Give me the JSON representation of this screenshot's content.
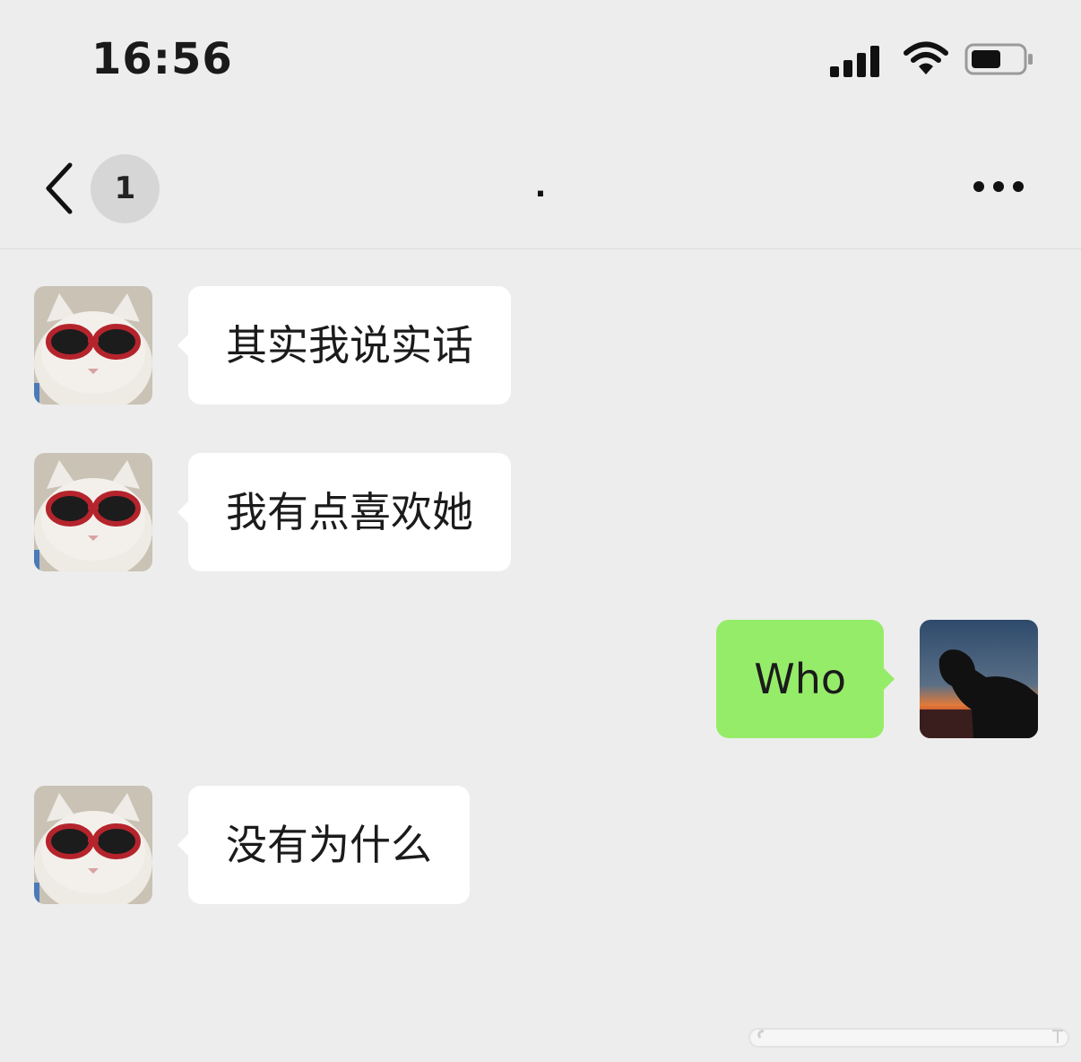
{
  "status_bar": {
    "time": "16:56",
    "icons": [
      "signal-icon",
      "wifi-icon",
      "battery-icon"
    ]
  },
  "nav": {
    "back_icon": "chevron-left-icon",
    "unread_count": "1",
    "title": ".",
    "more_icon": "more-dots-icon"
  },
  "messages": [
    {
      "side": "left",
      "text": "其实我说实话",
      "avatar": "cat-sunglasses-avatar"
    },
    {
      "side": "left",
      "text": "我有点喜欢她",
      "avatar": "cat-sunglasses-avatar"
    },
    {
      "side": "right",
      "text": "Who",
      "avatar": "sunset-silhouette-avatar"
    },
    {
      "side": "left",
      "text": "没有为什么",
      "avatar": "cat-sunglasses-avatar"
    }
  ],
  "colors": {
    "background": "#ededed",
    "bubble_left": "#ffffff",
    "bubble_right": "#95ec69",
    "badge": "#d6d6d6"
  }
}
